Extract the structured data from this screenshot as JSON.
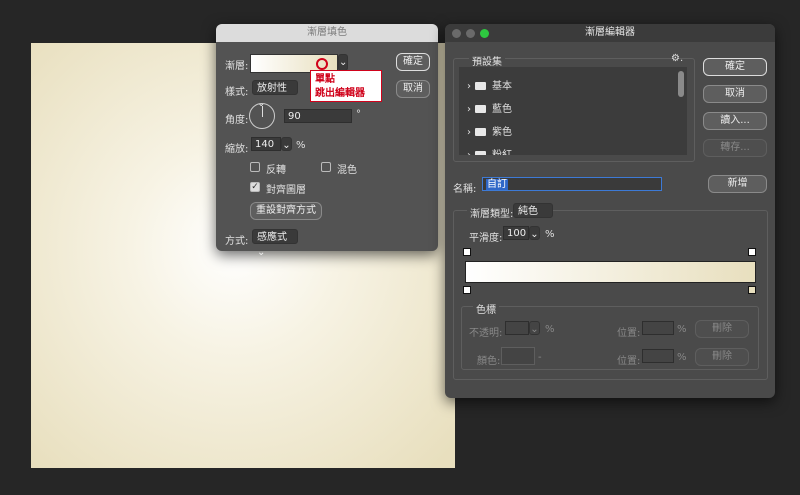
{
  "fill_dialog": {
    "title": "漸層填色",
    "gradient_label": "漸層:",
    "style_label": "樣式:",
    "style_value": "放射性",
    "angle_label": "角度:",
    "angle_value": "90",
    "degree_symbol": "°",
    "scale_label": "縮放:",
    "scale_value": "140",
    "percent": "%",
    "reverse_label": "反轉",
    "dither_label": "混色",
    "align_label": "對齊圖層",
    "reset_align_label": "重設對齊方式",
    "method_label": "方式:",
    "method_value": "感應式",
    "ok_label": "確定",
    "cancel_label": "取消",
    "annotation_line1": "單點",
    "annotation_line2": "跳出編輯器"
  },
  "editor": {
    "title": "漸層編輯器",
    "presets_label": "預設集",
    "presets": [
      {
        "label": "基本"
      },
      {
        "label": "藍色"
      },
      {
        "label": "紫色"
      },
      {
        "label": "粉紅"
      }
    ],
    "name_label": "名稱:",
    "name_value": "自訂",
    "new_label": "新增",
    "ok_label": "確定",
    "cancel_label": "取消",
    "load_label": "讀入...",
    "save_label": "轉存...",
    "type_label": "漸層類型:",
    "type_value": "純色",
    "smooth_label": "平滑度:",
    "smooth_value": "100",
    "percent": "%",
    "stops_label": "色標",
    "opacity_label": "不透明:",
    "color_label": "顏色:",
    "location_label": "位置:",
    "delete_label": "刪除",
    "dash": "-",
    "gradient_start": "#ffffff",
    "gradient_end": "#e8dfbe"
  }
}
